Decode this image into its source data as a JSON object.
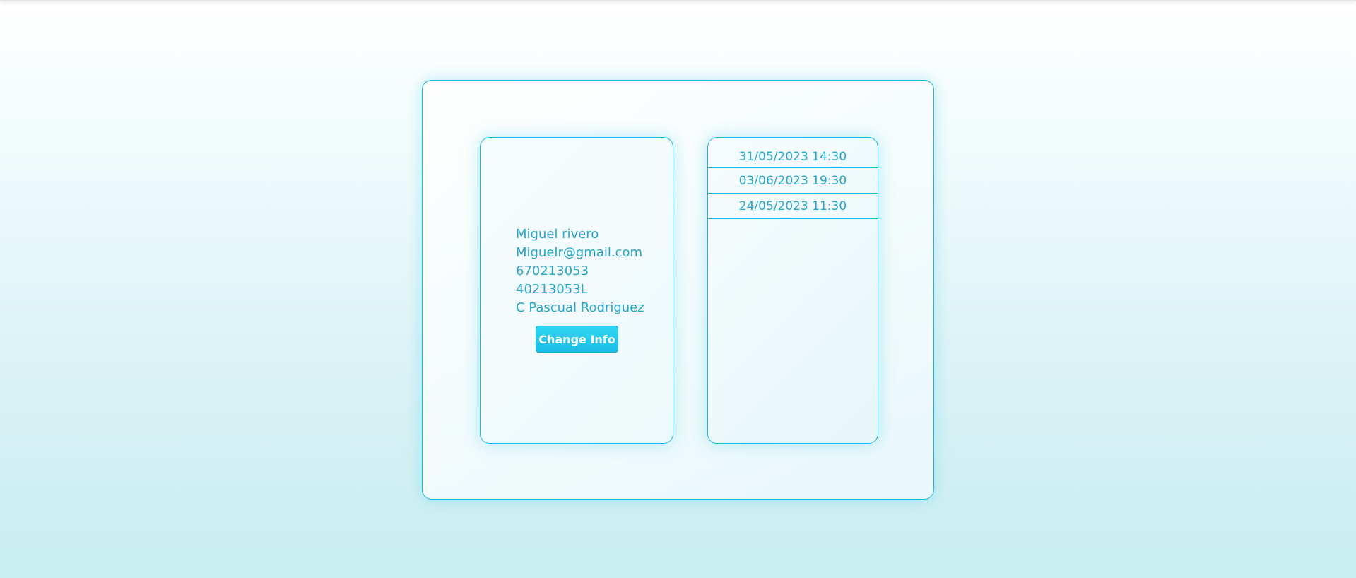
{
  "profile": {
    "name": "Miguel rivero",
    "email": "Miguelr@gmail.com",
    "phone": "670213053",
    "dni": "40213053L",
    "address": "C Pascual Rodriguez",
    "change_button_label": "Change Info"
  },
  "appointments": [
    {
      "datetime": "31/05/2023 14:30"
    },
    {
      "datetime": "03/06/2023 19:30"
    },
    {
      "datetime": "24/05/2023 11:30"
    }
  ],
  "colors": {
    "accent": "#1bb5e0",
    "text": "#27a6c9",
    "button": "#1bbde5"
  }
}
